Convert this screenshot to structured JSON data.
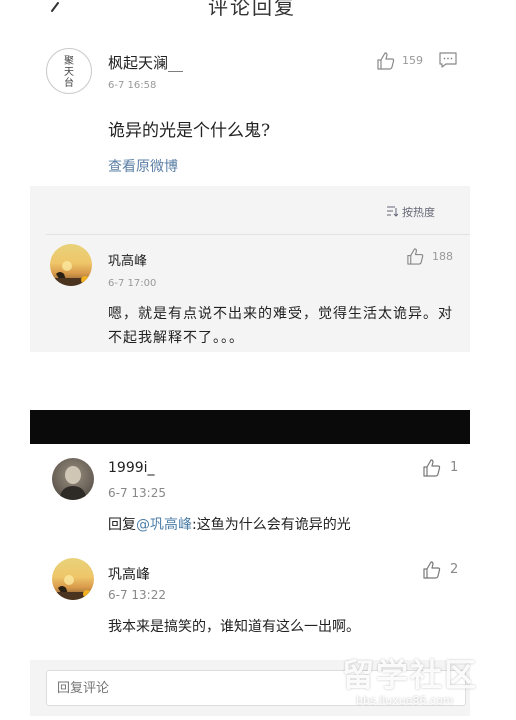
{
  "header": {
    "title": "评论回复"
  },
  "main_comment": {
    "avatar_text": "聚\n天\n台",
    "username": "枫起天澜__",
    "time": "6-7 16:58",
    "likes": "159",
    "text": "诡异的光是个什么鬼?",
    "view_original": "查看原微博"
  },
  "sort": {
    "label": "按热度"
  },
  "replies_top": [
    {
      "username": "巩高峰",
      "time": "6-7 17:00",
      "likes": "188",
      "text": "嗯，就是有点说不出来的难受，觉得生活太诡异。对不起我解释不了。。。"
    }
  ],
  "replies_bottom": [
    {
      "username": "1999i_",
      "time": "6-7 13:25",
      "likes": "1",
      "prefix": "回复",
      "mention": "@巩高峰",
      "text": ":这鱼为什么会有诡异的光"
    },
    {
      "username": "巩高峰",
      "time": "6-7 13:22",
      "likes": "2",
      "text": "我本来是搞笑的，谁知道有这么一出啊。"
    }
  ],
  "reply_box": {
    "placeholder": "回复评论"
  },
  "watermark": {
    "logo": "留学社区",
    "url": "bbs.liuxue86.com"
  },
  "colors": {
    "link": "#5b7fa6",
    "mention": "#4d7ea8",
    "muted": "#999999",
    "reply_bg": "#f4f4f4"
  }
}
